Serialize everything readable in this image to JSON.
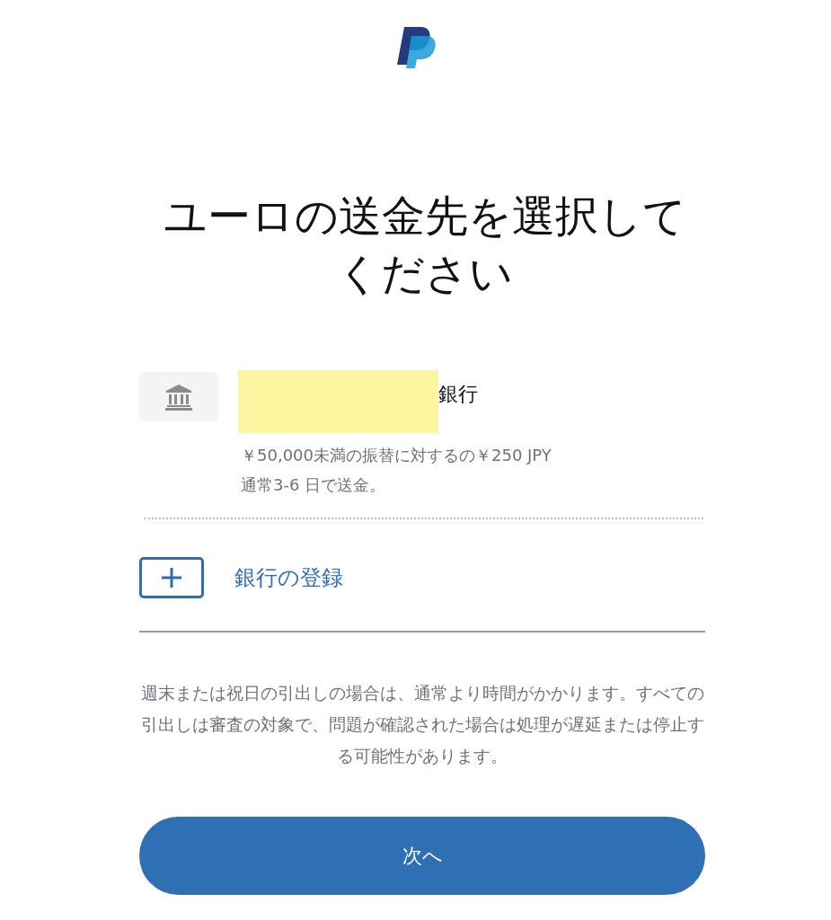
{
  "title": "ユーロの送金先を選択してください",
  "bank": {
    "name": "銀行",
    "fee": "￥50,000未満の振替に対するの￥250 JPY",
    "timing": "通常3-6 日で送金。"
  },
  "add_bank": {
    "label": "銀行の登録"
  },
  "note": "週末または祝日の引出しの場合は、通常より時間がかかります。すべての引出しは審査の対象で、問題が確認された場合は処理が遅延または停止する可能性があります。",
  "next_button": "次へ"
}
